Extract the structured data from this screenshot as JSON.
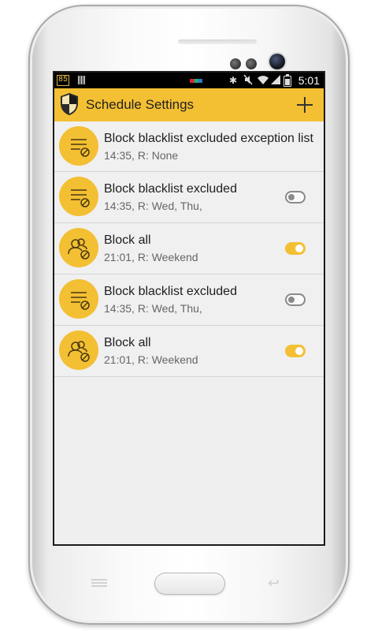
{
  "status_bar": {
    "badge": "85",
    "time": "5:01",
    "icons": [
      "barcode-icon",
      "bluetooth-icon",
      "mute-icon",
      "wifi-icon",
      "signal-icon",
      "battery-icon"
    ]
  },
  "action_bar": {
    "title": "Schedule Settings",
    "add_icon": "plus-icon",
    "logo_icon": "shield-icon"
  },
  "schedules": [
    {
      "title": "Block blacklist excluded exception list",
      "subtitle": "14:35, R: None",
      "icon": "list-block-icon",
      "toggle": null
    },
    {
      "title": "Block blacklist excluded",
      "subtitle": "14:35, R: Wed, Thu,",
      "icon": "list-block-icon",
      "toggle": false
    },
    {
      "title": "Block all",
      "subtitle": "21:01, R: Weekend",
      "icon": "people-block-icon",
      "toggle": true
    },
    {
      "title": "Block blacklist excluded",
      "subtitle": "14:35, R: Wed, Thu,",
      "icon": "list-block-icon",
      "toggle": false
    },
    {
      "title": "Block all",
      "subtitle": "21:01, R: Weekend",
      "icon": "people-block-icon",
      "toggle": true
    }
  ],
  "colors": {
    "accent": "#f3bf33",
    "list_background": "#efefef",
    "status_bar": "#000000"
  }
}
